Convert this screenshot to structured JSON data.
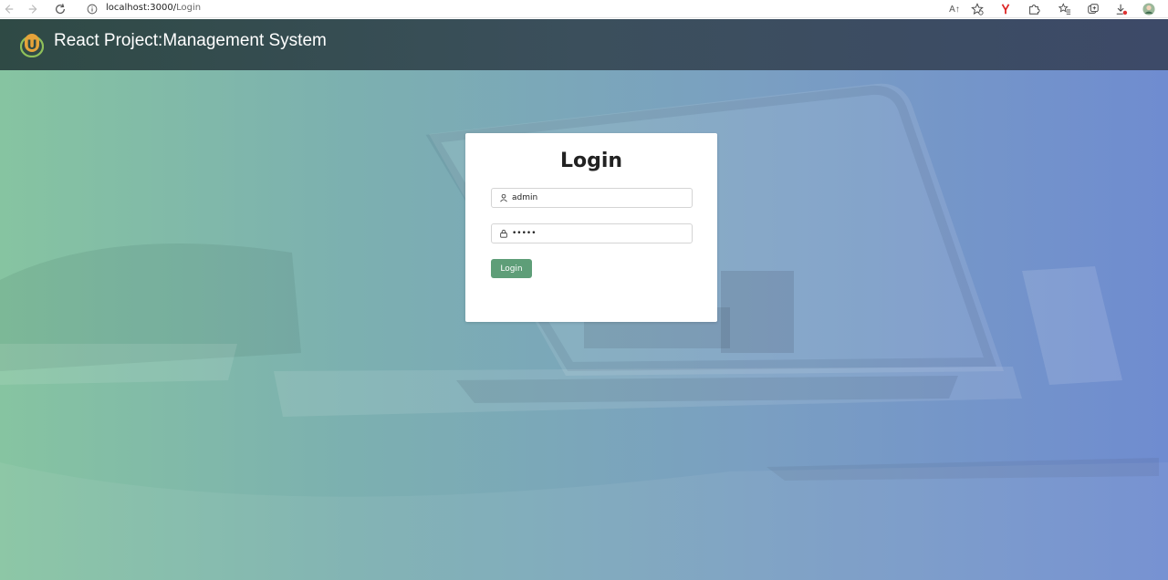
{
  "browser": {
    "url_host": "localhost:3000/",
    "url_path": "Login",
    "read_aloud_label": "A↑",
    "icons": [
      "back-icon",
      "forward-icon",
      "reload-icon",
      "info-icon",
      "read-aloud-icon",
      "favorite-star-icon",
      "yandex-icon",
      "extensions-icon",
      "favorites-icon",
      "collections-icon",
      "downloads-icon",
      "profile-avatar-icon"
    ]
  },
  "header": {
    "title": "React Project:Management System",
    "logo_letter": "U",
    "colors": {
      "logo_outer": "#8fc05a",
      "logo_inner": "#e6a33a"
    }
  },
  "login": {
    "title": "Login",
    "username_value": "admin",
    "password_value": "admin",
    "button_label": "Login",
    "colors": {
      "button": "#5e9e78"
    }
  }
}
